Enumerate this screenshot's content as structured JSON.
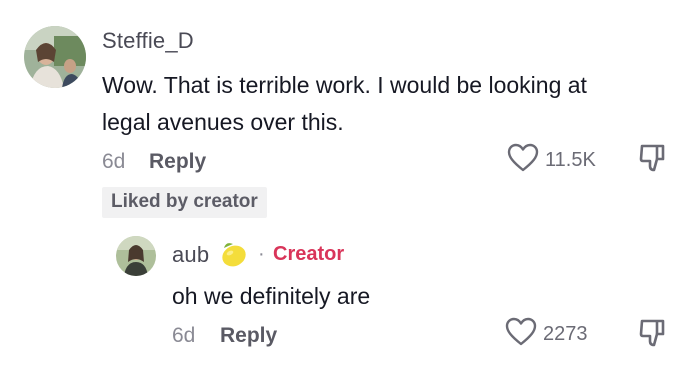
{
  "comment": {
    "username": "Steffie_D",
    "text_line1": "Wow. That is terrible work. I would be looking at",
    "text_line2": "legal avenues over this.",
    "time": "6d",
    "reply_label": "Reply",
    "likes": "11.5K",
    "liked_badge": "Liked by creator"
  },
  "reply": {
    "username": "aub",
    "creator_label": "Creator",
    "separator": "·",
    "text": "oh we definitely are",
    "time": "6d",
    "reply_label": "Reply",
    "likes": "2273"
  },
  "icons": {
    "like": "heart-outline-icon",
    "dislike": "thumbs-down-icon",
    "emoji": "lemon-emoji-icon"
  },
  "colors": {
    "creator_accent": "#d9355a",
    "badge_bg": "#f1f1f2"
  }
}
